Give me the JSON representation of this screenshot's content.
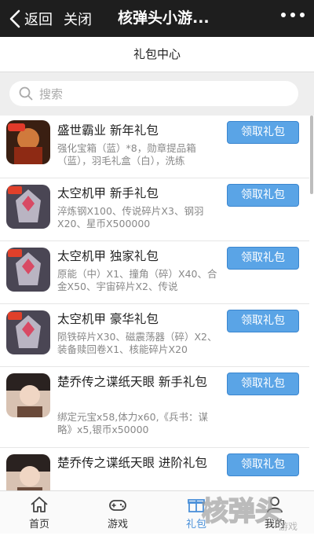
{
  "topbar": {
    "back_label": "返回",
    "close_label": "关闭",
    "title": "核弹头小游..."
  },
  "subheader": {
    "title": "礼包中心"
  },
  "search": {
    "placeholder": "搜索"
  },
  "items": [
    {
      "name": "盛世霸业 新年礼包",
      "desc": "强化宝箱（蓝）*8，勋章提品箱（蓝），羽毛礼盒（白），洗练",
      "button": "领取礼包",
      "icon": "warrior-game-icon",
      "color": "#b5461f"
    },
    {
      "name": "太空机甲 新手礼包",
      "desc": "淬炼钢X100、传说碎片X3、钢羽X20、星币X500000",
      "button": "领取礼包",
      "icon": "mecha-game-icon",
      "color": "#6b5f6f"
    },
    {
      "name": "太空机甲 独家礼包",
      "desc": "原能（中）X1、撞角（碎）X40、合金X50、宇宙碎片X2、传说",
      "button": "领取礼包",
      "icon": "mecha-game-icon",
      "color": "#6b5f6f"
    },
    {
      "name": "太空机甲 豪华礼包",
      "desc": "陨铁碎片X30、磁震荡器（碎）X2、装备赎回卷X1、核能碎片X20",
      "button": "领取礼包",
      "icon": "mecha-game-icon",
      "color": "#6b5f6f"
    },
    {
      "name": "楚乔传之谍纸天眼 新手礼包",
      "desc": "绑定元宝x58,体力x60,《兵书：谋略》x5,银币x50000",
      "button": "领取礼包",
      "icon": "portrait-game-icon",
      "color": "#c9a690"
    },
    {
      "name": "楚乔传之谍纸天眼 进阶礼包",
      "desc": "",
      "button": "领取礼包",
      "icon": "portrait-game-icon",
      "color": "#c9a690"
    }
  ],
  "bottom_nav": [
    {
      "label": "首页",
      "icon": "home-icon"
    },
    {
      "label": "游戏",
      "icon": "gamepad-icon"
    },
    {
      "label": "礼包",
      "icon": "gift-icon"
    },
    {
      "label": "我的",
      "icon": "user-icon"
    }
  ],
  "watermark": {
    "text": "核弹头游戏"
  }
}
